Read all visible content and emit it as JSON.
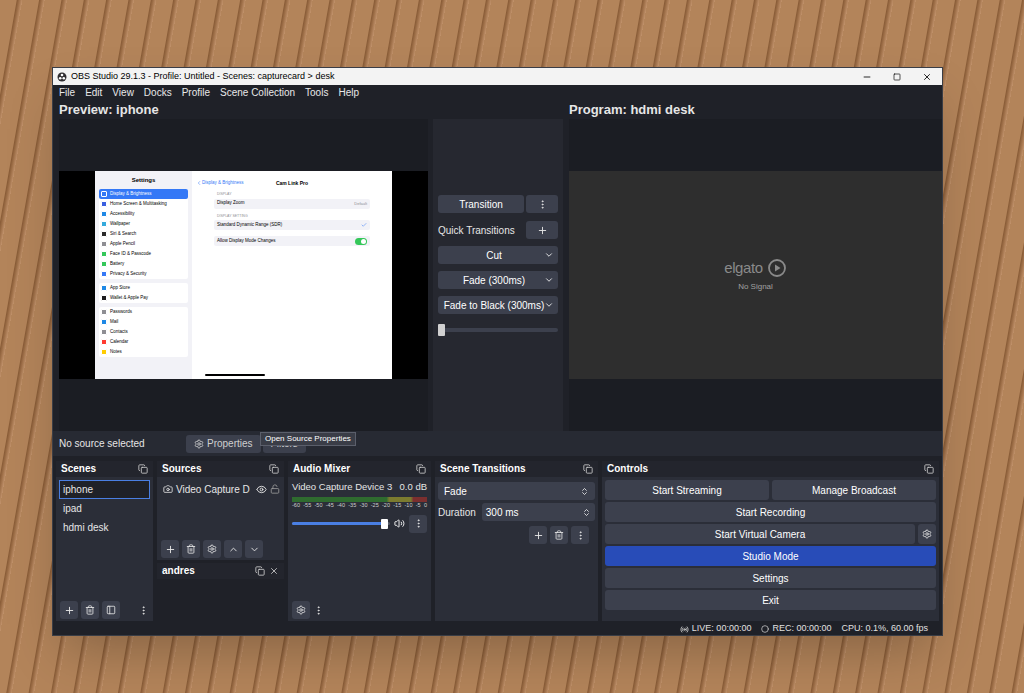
{
  "window": {
    "title": "OBS Studio 29.1.3 - Profile: Untitled - Scenes: capturecard > desk"
  },
  "menu": [
    "File",
    "Edit",
    "View",
    "Docks",
    "Profile",
    "Scene Collection",
    "Tools",
    "Help"
  ],
  "preview": {
    "label": "Preview: iphone",
    "device": {
      "sidebar": {
        "title": "Settings",
        "groups": [
          [
            {
              "name": "Display & Brightness",
              "selected": true,
              "color": "#3478f6"
            },
            {
              "name": "Home Screen & Multitasking",
              "selected": false,
              "color": "#3a5fe0"
            },
            {
              "name": "Accessibility",
              "selected": false,
              "color": "#1e88e5"
            },
            {
              "name": "Wallpaper",
              "selected": false,
              "color": "#34aadc"
            },
            {
              "name": "Siri & Search",
              "selected": false,
              "color": "#2b2b2b"
            },
            {
              "name": "Apple Pencil",
              "selected": false,
              "color": "#8e8e93"
            },
            {
              "name": "Face ID & Passcode",
              "selected": false,
              "color": "#34c759"
            },
            {
              "name": "Battery",
              "selected": false,
              "color": "#34c759"
            },
            {
              "name": "Privacy & Security",
              "selected": false,
              "color": "#3478f6"
            }
          ],
          [
            {
              "name": "App Store",
              "selected": false,
              "color": "#1e88e5"
            },
            {
              "name": "Wallet & Apple Pay",
              "selected": false,
              "color": "#1c1c1e"
            }
          ],
          [
            {
              "name": "Passwords",
              "selected": false,
              "color": "#8e8e93"
            },
            {
              "name": "Mail",
              "selected": false,
              "color": "#1e88e5"
            },
            {
              "name": "Contacts",
              "selected": false,
              "color": "#8e8e93"
            },
            {
              "name": "Calendar",
              "selected": false,
              "color": "#ff3b30"
            },
            {
              "name": "Notes",
              "selected": false,
              "color": "#ffcc00"
            }
          ]
        ]
      },
      "detail": {
        "back": "Display & Brightness",
        "title": "Cam Link Pro",
        "sections": [
          {
            "header": "DISPLAY",
            "rows": [
              {
                "kind": "value",
                "label": "Display Zoom",
                "value": "Default"
              }
            ]
          },
          {
            "header": "DISPLAY SETTING",
            "rows": [
              {
                "kind": "check",
                "label": "Standard Dynamic Range (SDR)",
                "checked": true
              }
            ]
          },
          {
            "header": "",
            "rows": [
              {
                "kind": "toggle",
                "label": "Allow Display Mode Changes",
                "on": true
              }
            ]
          }
        ]
      }
    }
  },
  "program": {
    "label": "Program: hdmi desk",
    "logo": "elgato",
    "message": "No Signal"
  },
  "transitions": {
    "button": "Transition",
    "quick_label": "Quick Transitions",
    "quick": [
      {
        "label": "Cut"
      },
      {
        "label": "Fade (300ms)"
      },
      {
        "label": "Fade to Black (300ms)"
      }
    ],
    "tbar": {
      "level": 0
    }
  },
  "properties_bar": {
    "label": "No source selected",
    "buttons": [
      {
        "label": "Properties"
      },
      {
        "label": "Filters"
      }
    ],
    "tooltip": "Open Source Properties"
  },
  "docks": {
    "scenes": {
      "title": "Scenes",
      "items": [
        {
          "name": "iphone",
          "selected": true
        },
        {
          "name": "ipad",
          "selected": false
        },
        {
          "name": "hdmi desk",
          "selected": false
        }
      ]
    },
    "sources": {
      "title": "Sources",
      "items": [
        {
          "name": "Video Capture D",
          "visible": true,
          "locked": false
        }
      ]
    },
    "custom": {
      "title": "andres"
    },
    "audio_mixer": {
      "title": "Audio Mixer",
      "channels": [
        {
          "name": "Video Capture Device 3",
          "reading": "0.0 dB",
          "level": 0.95,
          "muted": false
        }
      ],
      "scale": [
        "-60",
        "-55",
        "-50",
        "-45",
        "-40",
        "-35",
        "-30",
        "-25",
        "-20",
        "-15",
        "-10",
        "-5",
        "0"
      ]
    },
    "scene_transitions": {
      "title": "Scene Transitions",
      "transition": "Fade",
      "duration_label": "Duration",
      "duration": "300 ms"
    },
    "controls": {
      "title": "Controls",
      "rows": [
        [
          {
            "label": "Start Streaming",
            "selected": false,
            "kind": "button"
          },
          {
            "label": "Manage Broadcast",
            "selected": false,
            "kind": "button"
          }
        ],
        [
          {
            "label": "Start Recording",
            "selected": false,
            "kind": "button"
          }
        ],
        [
          {
            "label": "Start Virtual Camera",
            "selected": false,
            "kind": "with-settings"
          }
        ],
        [
          {
            "label": "Studio Mode",
            "selected": true,
            "kind": "button"
          }
        ],
        [
          {
            "label": "Settings",
            "selected": false,
            "kind": "button"
          }
        ],
        [
          {
            "label": "Exit",
            "selected": false,
            "kind": "button"
          }
        ]
      ]
    }
  },
  "status_bar": {
    "live": "LIVE: 00:00:00",
    "rec": "REC: 00:00:00",
    "cpu": "CPU: 0.1%, 60.00 fps"
  }
}
